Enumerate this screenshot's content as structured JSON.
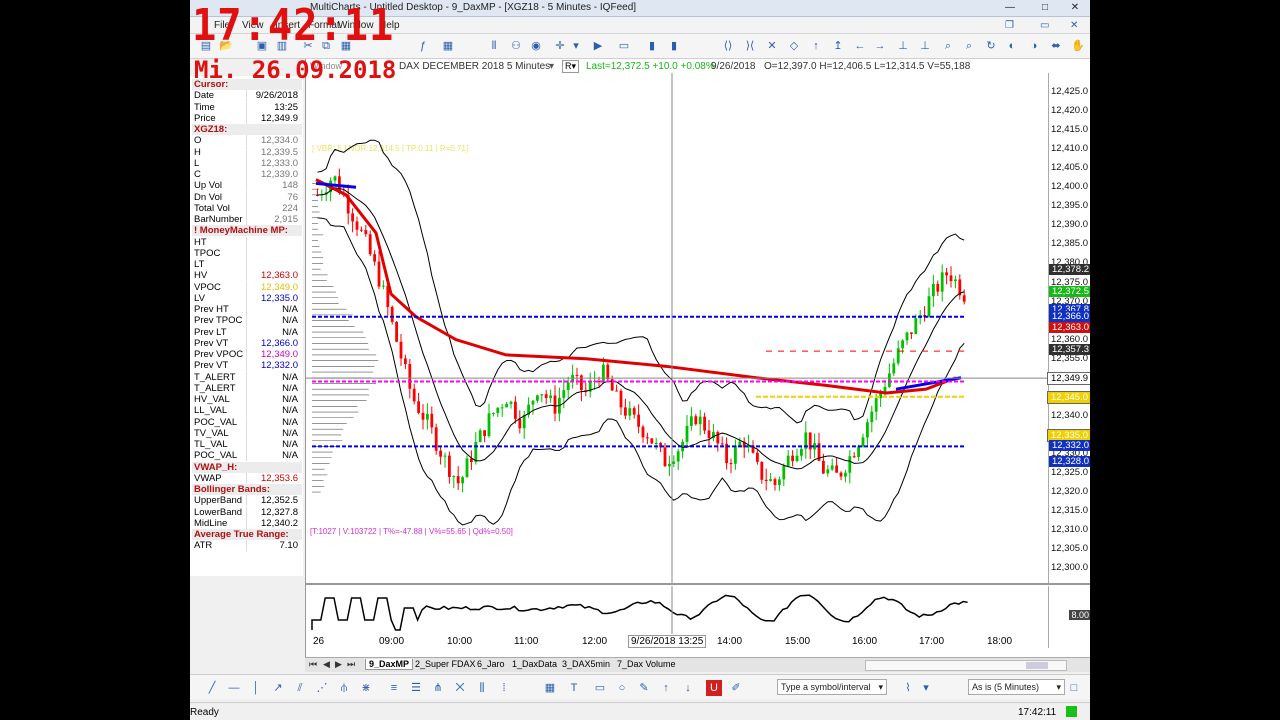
{
  "overlay": {
    "clock": "17:42:11",
    "date": "Mi. 26.09.2018"
  },
  "titlebar": {
    "title": "MultiCharts - Untitled Desktop - 9_DaxMP - [XGZ18 - 5 Minutes - IQFeed]"
  },
  "menu": [
    "File",
    "View",
    "Insert",
    "Format",
    "Window",
    "Help"
  ],
  "datawindow": {
    "title": "Window",
    "rows": [
      {
        "k": "Cursor:",
        "v": "",
        "hdr": true
      },
      {
        "k": "Date",
        "v": "9/26/2018"
      },
      {
        "k": "Time",
        "v": "13:25"
      },
      {
        "k": "Price",
        "v": "12,349.9"
      },
      {
        "k": "XGZ18:",
        "v": "",
        "hdr": true
      },
      {
        "k": "O",
        "v": "12,334.0",
        "c": "#777"
      },
      {
        "k": "H",
        "v": "12,339.5",
        "c": "#777"
      },
      {
        "k": "L",
        "v": "12,333.0",
        "c": "#777"
      },
      {
        "k": "C",
        "v": "12,339.0",
        "c": "#777"
      },
      {
        "k": "Up Vol",
        "v": "148",
        "c": "#777"
      },
      {
        "k": "Dn Vol",
        "v": "76",
        "c": "#777"
      },
      {
        "k": "Total Vol",
        "v": "224",
        "c": "#777"
      },
      {
        "k": "BarNumber",
        "v": "2,915",
        "c": "#777"
      },
      {
        "k": "! MoneyMachine MP:",
        "v": "",
        "hdr": true
      },
      {
        "k": "HT",
        "v": ""
      },
      {
        "k": "TPOC",
        "v": ""
      },
      {
        "k": "LT",
        "v": ""
      },
      {
        "k": "HV",
        "v": "12,363.0",
        "c": "#d00000"
      },
      {
        "k": "VPOC",
        "v": "12,349.0",
        "c": "#e0c000"
      },
      {
        "k": "LV",
        "v": "12,335.0",
        "c": "#0000cc"
      },
      {
        "k": "Prev HT",
        "v": "N/A"
      },
      {
        "k": "Prev TPOC",
        "v": "N/A"
      },
      {
        "k": "Prev LT",
        "v": "N/A"
      },
      {
        "k": "Prev VT",
        "v": "12,366.0",
        "c": "#0000cc"
      },
      {
        "k": "Prev VPOC",
        "v": "12,349.0",
        "c": "#cc00cc"
      },
      {
        "k": "Prev VT",
        "v": "12,332.0",
        "c": "#0000cc"
      },
      {
        "k": "T_ALERT",
        "v": "N/A"
      },
      {
        "k": "T_ALERT",
        "v": "N/A"
      },
      {
        "k": "HV_VAL",
        "v": "N/A"
      },
      {
        "k": "LL_VAL",
        "v": "N/A"
      },
      {
        "k": "POC_VAL",
        "v": "N/A"
      },
      {
        "k": "TV_VAL",
        "v": "N/A"
      },
      {
        "k": "TL_VAL",
        "v": "N/A"
      },
      {
        "k": "POC_VAL",
        "v": "N/A"
      },
      {
        "k": "VWAP_H:",
        "v": "",
        "hdr": true
      },
      {
        "k": "VWAP",
        "v": "12,353.6",
        "c": "#d00000"
      },
      {
        "k": "Bollinger Bands:",
        "v": "",
        "hdr": true
      },
      {
        "k": "UpperBand",
        "v": "12,352.5"
      },
      {
        "k": "LowerBand",
        "v": "12,327.8"
      },
      {
        "k": "MidLine",
        "v": "12,340.2"
      },
      {
        "k": "Average True Range:",
        "v": "",
        "hdr": true
      },
      {
        "k": "ATR",
        "v": "7.10"
      }
    ]
  },
  "chart": {
    "header": {
      "symbol": "DAX DECEMBER 2018  5 Minutes",
      "last": "Last=12,372.5  +10.0  +0.08%",
      "date": "9/26/2018",
      "ohlc": "O=12,397.0   H=12,406.5   L=12,314.5   V=55,188"
    },
    "label_yellow": "[ VBR: 5 ] NOR:12,314.5 | TP:0.11 | R=0.71]",
    "stats": "[T:1027 | V:103722 | T%=-47.88 | V%=55.65 | Qd%=0.50]",
    "price_labels": [
      "12,425.0",
      "12,420.0",
      "12,415.0",
      "12,410.0",
      "12,405.0",
      "12,400.0",
      "12,395.0",
      "12,390.0",
      "12,385.0",
      "12,380.0",
      "12,375.0",
      "12,370.0",
      "12,365.0",
      "12,360.0",
      "12,355.0",
      "12,350.0",
      "12,345.0",
      "12,340.0",
      "12,335.0",
      "12,330.0",
      "12,325.0",
      "12,320.0",
      "12,315.0",
      "12,310.0",
      "12,305.0",
      "12,300.0"
    ],
    "price_boxes": [
      {
        "v": "12,378.2",
        "bg": "#303030"
      },
      {
        "v": "12,372.5",
        "bg": "#18b818"
      },
      {
        "v": "12,367.8",
        "bg": "#1030c0"
      },
      {
        "v": "12,366.0",
        "bg": "#1030c0"
      },
      {
        "v": "12,363.0",
        "bg": "#d01010"
      },
      {
        "v": "12,357.3",
        "bg": "#303030"
      },
      {
        "v": "12,349.9",
        "bg": "#ffffff"
      },
      {
        "v": "12,345.0",
        "bg": "#f0d000"
      },
      {
        "v": "12,335.0",
        "bg": "#f0d000"
      },
      {
        "v": "12,332.0",
        "bg": "#1030c0"
      },
      {
        "v": "12,328.0",
        "bg": "#1030c0"
      }
    ],
    "ind_label": "8.00",
    "time_labels": [
      "26",
      "09:00",
      "10:00",
      "11:00",
      "12:00",
      "14:00",
      "15:00",
      "16:00",
      "17:00",
      "18:00"
    ],
    "cursor_time": "9/26/2018 13:25",
    "colors": {
      "vwap": "#e00000",
      "boll": "#000000",
      "up": "#00c000",
      "down": "#ff0000",
      "blue": "#0000ee",
      "magenta": "#ff00ff",
      "yellow": "#f0d000"
    }
  },
  "tabs": [
    "9_DaxMP",
    "2_Super FDAX",
    "6_Jaro",
    "1_DaxData",
    "3_DAX5min",
    "7_Dax Volume"
  ],
  "drawbar": {
    "symbol_placeholder": "Type a symbol/interval",
    "interval": "As is (5 Minutes)"
  },
  "status": {
    "left": "Ready",
    "time": "17:42:11"
  }
}
